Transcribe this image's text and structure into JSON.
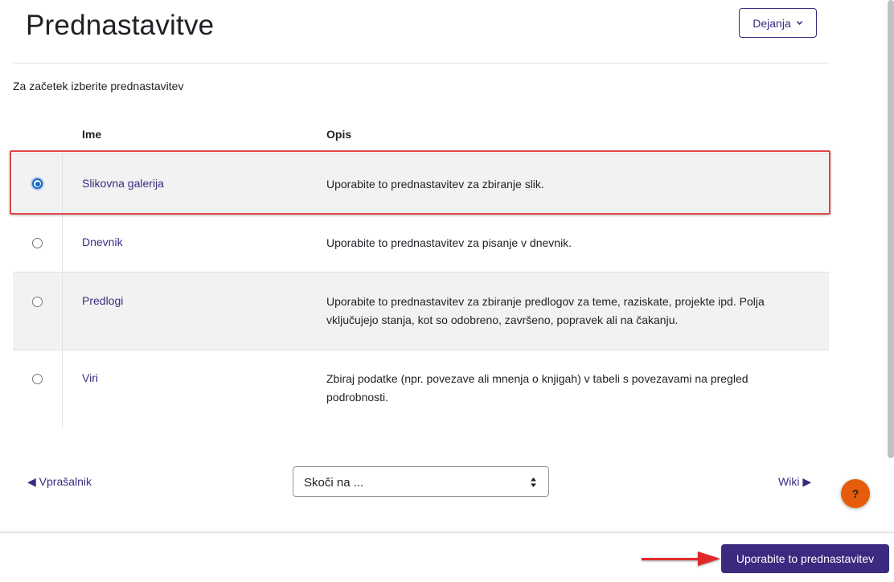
{
  "header": {
    "title": "Prednastavitve",
    "actions_label": "Dejanja"
  },
  "intro": "Za začetek izberite prednastavitev",
  "table": {
    "columns": [
      "Ime",
      "Opis"
    ],
    "rows": [
      {
        "name": "Slikovna galerija",
        "description": "Uporabite to prednastavitev za zbiranje slik.",
        "selected": true
      },
      {
        "name": "Dnevnik",
        "description": "Uporabite to prednastavitev za pisanje v dnevnik.",
        "selected": false
      },
      {
        "name": "Predlogi",
        "description": "Uporabite to prednastavitev za zbiranje predlogov za teme, raziskate, projekte ipd. Polja vključujejo stanja, kot so odobreno, završeno, popravek ali na čakanju.",
        "selected": false
      },
      {
        "name": "Viri",
        "description": "Zbiraj podatke (npr. povezave ali mnenja o knjigah) v tabeli s povezavami na pregled podrobnosti.",
        "selected": false
      }
    ]
  },
  "navigation": {
    "prev_label": "◀ Vprašalnik",
    "next_label": "Wiki ▶",
    "jump_placeholder": "Skoči na ..."
  },
  "help": {
    "label": "?"
  },
  "footer": {
    "apply_label": "Uporabite to prednastavitev"
  },
  "colors": {
    "primary": "#3b2a80",
    "highlight": "#e04646",
    "help": "#e55d0c",
    "row_shade": "#f2f2f2"
  }
}
